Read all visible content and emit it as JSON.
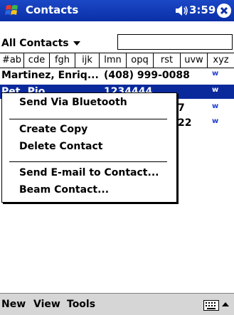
{
  "titlebar": {
    "app_title": "Contacts",
    "time": "3:59"
  },
  "category": {
    "label": "All Contacts"
  },
  "tabs": [
    "#ab",
    "cde",
    "fgh",
    "ijk",
    "lmn",
    "opq",
    "rst",
    "uvw",
    "xyz"
  ],
  "contacts": [
    {
      "name": "Martinez, Enriq...",
      "phone": "(408) 999-0088",
      "tag": "w"
    },
    {
      "name": "Pet, Pio",
      "phone": "1234444",
      "tag": "w"
    },
    {
      "name": "",
      "phone": "7",
      "tag": "w"
    },
    {
      "name": "",
      "phone": "22",
      "tag": "w"
    }
  ],
  "context_menu": {
    "send_bluetooth": "Send Via Bluetooth",
    "create_copy": "Create Copy",
    "delete_contact": "Delete Contact",
    "send_email": "Send E-mail to Contact...",
    "beam_contact": "Beam Contact..."
  },
  "bottombar": {
    "new": "New",
    "view": "View",
    "tools": "Tools"
  },
  "colors": {
    "titlebar": "#0a2fa8",
    "selection": "#0a2a9c",
    "tag": "#1f3cd1",
    "bottombar": "#d6d6d6"
  },
  "icons": {
    "start": "windows-flag-icon",
    "volume": "speaker-icon",
    "close": "close-icon",
    "keyboard": "keyboard-icon",
    "sip": "up-arrow-icon"
  }
}
